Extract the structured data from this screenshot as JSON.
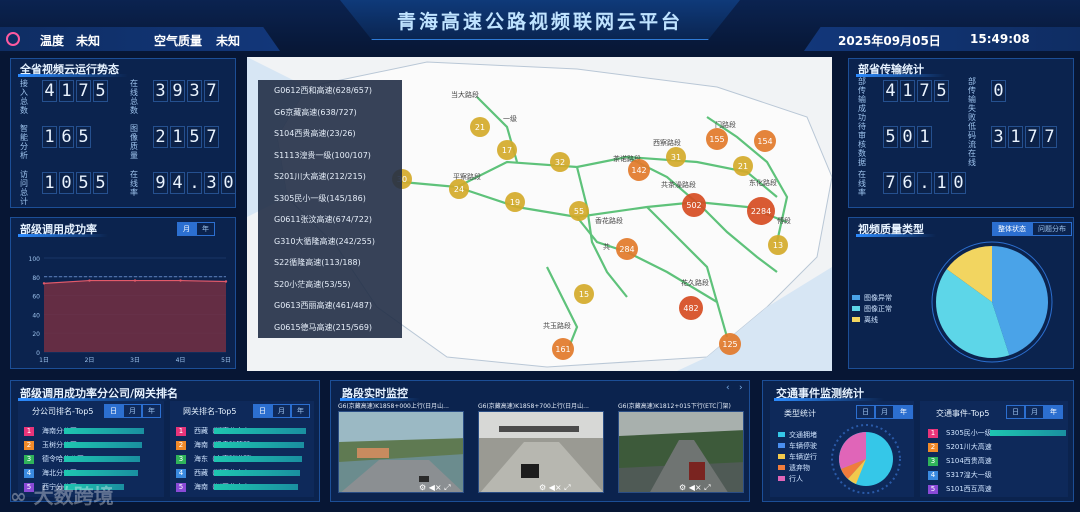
{
  "header": {
    "title": "青海高速公路视频联网云平台",
    "temp_label": "温度",
    "temp_value": "未知",
    "air_label": "空气质量",
    "air_value": "未知",
    "date": "2025年09月05日",
    "time": "15:49:08"
  },
  "province_video": {
    "title": "全省视频云运行势态",
    "tiles": [
      {
        "label": "接入总数",
        "digits": [
          "4",
          "1",
          "7",
          "5"
        ]
      },
      {
        "label": "在线总数",
        "digits": [
          "3",
          "9",
          "3",
          "7"
        ]
      },
      {
        "label": "智能分析",
        "digits": [
          "1",
          "6",
          "5"
        ]
      },
      {
        "label": "图像质量",
        "digits": [
          "2",
          "1",
          "5",
          "7"
        ]
      },
      {
        "label": "访问总计",
        "digits": [
          "1",
          "0",
          "5",
          "5"
        ]
      },
      {
        "label": "在线率",
        "digits": [
          "9",
          "4",
          ".",
          "3",
          "0"
        ]
      }
    ]
  },
  "dept_transfer": {
    "title": "部省传输统计",
    "tiles": [
      {
        "label": "部传输成功",
        "digits": [
          "4",
          "1",
          "7",
          "5"
        ]
      },
      {
        "label": "部传输失败",
        "digits": [
          "0"
        ]
      },
      {
        "label": "待审核数据",
        "digits": [
          "5",
          "0",
          "1"
        ]
      },
      {
        "label": "低码流在线",
        "digits": [
          "3",
          "1",
          "7",
          "7"
        ]
      },
      {
        "label": "在线率",
        "digits": [
          "7",
          "6",
          ".",
          "1",
          "0"
        ]
      }
    ]
  },
  "call_success": {
    "title": "部级调用成功率",
    "tabs": [
      "月",
      "年"
    ],
    "y_ticks": [
      "100",
      "80",
      "60",
      "40",
      "20",
      "0"
    ],
    "x_ticks": [
      "1日",
      "2日",
      "3日",
      "4日",
      "5日"
    ]
  },
  "chart_data": {
    "type": "area",
    "title": "部级调用成功率",
    "x": [
      "1日",
      "2日",
      "3日",
      "4日",
      "5日"
    ],
    "values": [
      73,
      76,
      76,
      76,
      75
    ],
    "ylim": [
      0,
      100
    ],
    "grid": true,
    "reference_line": 80
  },
  "road_list": [
    "G0612西和高速(628/657)",
    "G6京藏高速(638/727)",
    "S104西贵高速(23/26)",
    "S1113湟贵一级(100/107)",
    "S201川大高速(212/215)",
    "S305民小一级(145/186)",
    "G0611张汶高速(674/722)",
    "G310大循隆高速(242/255)",
    "S22循隆高速(113/188)",
    "S20小茫高速(53/55)",
    "G0613西丽高速(461/487)",
    "G0615德马高速(215/569)"
  ],
  "map": {
    "clusters": [
      "21",
      "17",
      "32",
      "31",
      "155",
      "154",
      "21",
      "142",
      "24",
      "19",
      "55",
      "502",
      "2284",
      "13",
      "284",
      "15",
      "482",
      "161",
      "125",
      "30"
    ],
    "place_labels": [
      "当大路段",
      "一级",
      "西察路段",
      "门路段",
      "茶诺路段",
      "共茶澡路段",
      "东化路段",
      "平察路段",
      "香花路段",
      "花久路段",
      "共玉路段",
      "傅段",
      "共"
    ]
  },
  "dept_rank": {
    "title": "部级调用成功率分公司/网关排名",
    "company": {
      "title": "分公司排名-Top5",
      "tabs": [
        "日",
        "月",
        "年"
      ],
      "items": [
        {
          "rank": "1",
          "name": "海南分公司"
        },
        {
          "rank": "2",
          "name": "玉树分公司"
        },
        {
          "rank": "3",
          "name": "德令哈分公司"
        },
        {
          "rank": "4",
          "name": "海北分公司"
        },
        {
          "rank": "5",
          "name": "西宁分公司"
        }
      ]
    },
    "gateway": {
      "title": "网关排名-Top5",
      "tabs": [
        "日",
        "月",
        "年"
      ],
      "items": [
        {
          "rank": "1",
          "name": "西藏（湖察分中心1）"
        },
        {
          "rank": "2",
          "name": "海南（温泉隧管所2）"
        },
        {
          "rank": "3",
          "name": "海东（古察隧道所）"
        },
        {
          "rank": "4",
          "name": "西藏（湖察分中心2）"
        },
        {
          "rank": "5",
          "name": "海南（川玉分中心2）"
        }
      ]
    }
  },
  "road_monitor": {
    "title": "路段实时监控",
    "videos": [
      {
        "caption": "G6(京藏高速)K1858+000上行(日月山..."
      },
      {
        "caption": "G6(京藏高速)K1858+700上行(日月山..."
      },
      {
        "caption": "G6(京藏高速)K1812+015下行(ETC门架)"
      }
    ]
  },
  "traffic_events": {
    "title": "交通事件监测统计",
    "type_title": "类型统计",
    "type_tabs": [
      "日",
      "月",
      "年"
    ],
    "legend": [
      "交通拥堵",
      "车辆停驶",
      "车辆逆行",
      "遗弃物",
      "行人"
    ],
    "legend_colors": [
      "#35c7e8",
      "#4a8ff0",
      "#f2c94c",
      "#f07c3c",
      "#e065b8"
    ],
    "top_title": "交通事件-Top5",
    "top_tabs": [
      "日",
      "月",
      "年"
    ],
    "top_items": [
      {
        "rank": "1",
        "name": "S305民小一级"
      },
      {
        "rank": "2",
        "name": "S201川大高速"
      },
      {
        "rank": "3",
        "name": "S104西贵高速"
      },
      {
        "rank": "4",
        "name": "S317湟大一级"
      },
      {
        "rank": "5",
        "name": "S101西互高速"
      }
    ]
  },
  "video_quality": {
    "title": "视频质量类型",
    "tabs": [
      "整体状态",
      "问题分布"
    ],
    "legend": [
      "图像异常",
      "图像正常",
      "离线"
    ],
    "legend_colors": [
      "#4aa3e8",
      "#5dd6e8",
      "#f2d560"
    ],
    "values": [
      45,
      40,
      15
    ]
  },
  "rank_colors": [
    "#e8347a",
    "#f08a2a",
    "#2fb35a",
    "#3a8ae0",
    "#8a4ad6"
  ],
  "watermark": "大数跨境"
}
